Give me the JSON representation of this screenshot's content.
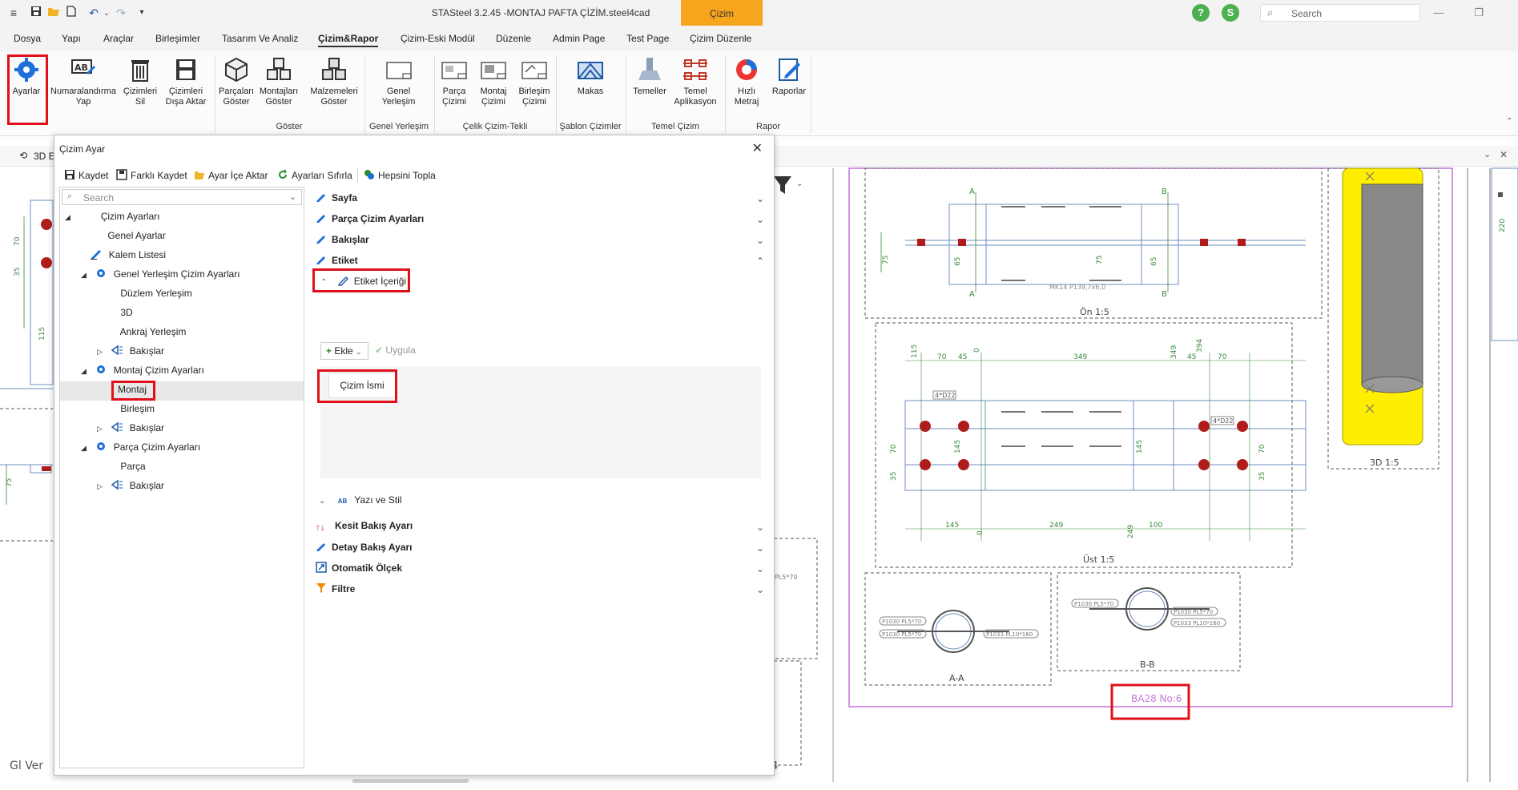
{
  "window": {
    "title": "STASteel 3.2.45 -MONTAJ PAFTA ÇİZİM.steel4cad",
    "search_placeholder": "Search",
    "context_tab_group": "Çizim",
    "user_initial": "S",
    "help_glyph": "?"
  },
  "menu": {
    "items": [
      "Dosya",
      "Yapı",
      "Araçlar",
      "Birleşimler",
      "Tasarım Ve Analiz",
      "Çizim&Rapor",
      "Çizim-Eski Modül",
      "Düzenle",
      "Admin Page",
      "Test Page",
      "Çizim Düzenle"
    ],
    "active": "Çizim&Rapor"
  },
  "ribbon": {
    "buttons": [
      {
        "label": "Ayarlar"
      },
      {
        "label": "Numaralandırma Yap"
      },
      {
        "label": "Çizimleri Sil"
      },
      {
        "label": "Çizimleri Dışa Aktar"
      },
      {
        "label": "Parçaları Göster"
      },
      {
        "label": "Montajları Göster"
      },
      {
        "label": "Malzemeleri Göster"
      },
      {
        "label": "Genel Yerleşim"
      },
      {
        "label": "Parça Çizimi"
      },
      {
        "label": "Montaj Çizimi"
      },
      {
        "label": "Birleşim Çizimi"
      },
      {
        "label": "Makas"
      },
      {
        "label": "Temeller"
      },
      {
        "label": "Temel Aplikasyon"
      },
      {
        "label": "Hızlı Metraj"
      },
      {
        "label": "Raporlar"
      }
    ],
    "groups": [
      "Göster",
      "Genel Yerleşim",
      "Çelik Çizim-Tekli",
      "Şablon Çizimler",
      "Temel Çizim",
      "Rapor"
    ]
  },
  "doc_tabs": {
    "first": "3D E"
  },
  "dialog": {
    "title": "Çizim Ayar",
    "toolbar": [
      "Kaydet",
      "Farklı Kaydet",
      "Ayar İçe Aktar",
      "Ayarları Sıfırla",
      "Hepsini Topla"
    ],
    "tree_search_placeholder": "Search",
    "tree": [
      {
        "label": "Çizim Ayarları",
        "level": 0,
        "expander": "◢"
      },
      {
        "label": "Genel Ayarlar",
        "level": 1,
        "expander": ""
      },
      {
        "label": "Kalem Listesi",
        "level": 1,
        "expander": ""
      },
      {
        "label": "Genel Yerleşim Çizim Ayarları",
        "level": 1,
        "expander": "◢"
      },
      {
        "label": "Düzlem Yerleşim",
        "level": 2,
        "expander": ""
      },
      {
        "label": "3D",
        "level": 2,
        "expander": ""
      },
      {
        "label": "Ankraj Yerleşim",
        "level": 2,
        "expander": ""
      },
      {
        "label": "Bakışlar",
        "level": 2,
        "expander": "▷"
      },
      {
        "label": "Montaj Çizim Ayarları",
        "level": 1,
        "expander": "◢"
      },
      {
        "label": "Montaj",
        "level": 2,
        "expander": ""
      },
      {
        "label": "Birleşim",
        "level": 2,
        "expander": ""
      },
      {
        "label": "Bakışlar",
        "level": 2,
        "expander": "▷"
      },
      {
        "label": "Parça Çizim Ayarları",
        "level": 1,
        "expander": "◢"
      },
      {
        "label": "Parça",
        "level": 2,
        "expander": ""
      },
      {
        "label": "Bakışlar",
        "level": 2,
        "expander": "▷"
      }
    ],
    "selected_tree": "Montaj",
    "sections_top": [
      "Sayfa",
      "Parça Çizim Ayarları",
      "Bakışlar",
      "Etiket"
    ],
    "sub_section": "Etiket İçeriği",
    "ekle": "Ekle",
    "uygula": "Uygula",
    "label_chip": "Çizim İsmi",
    "yazi_stil": "Yazı ve Stil",
    "sections_bottom": [
      "Kesit Bakış Ayarı",
      "Detay Bakış Ayarı",
      "Otomatik Ölçek",
      "Filtre"
    ]
  },
  "drawing": {
    "views": [
      "Ön 1:5",
      "Üst 1:5",
      "A-A",
      "B-B",
      "3D 1:5"
    ],
    "drawing_name": "BA28 No:6",
    "profile_label": "MK14 P139,7x6,0",
    "section_marks": [
      "A",
      "B"
    ],
    "front_dims": [
      "75",
      "65",
      "75",
      "65"
    ],
    "top_dims_row1": [
      "115",
      "70",
      "45",
      "0",
      "349",
      "349",
      "45",
      "70",
      "394"
    ],
    "top_dims_row2": [
      "145",
      "0",
      "249",
      "249",
      "100"
    ],
    "top_side_dims": [
      "70",
      "35",
      "145",
      "145",
      "70",
      "35"
    ],
    "bolt_labels": [
      "4*D22",
      "4*D22"
    ],
    "section_labels_a": [
      "P1030 PL5*70",
      "P1030 PL5*70",
      "P1033 PL10*160"
    ],
    "section_labels_b": [
      "P1030 PL5*70",
      "P1030 PL5*70",
      "P1033 PL10*160"
    ],
    "left_dims": [
      "70",
      "35",
      "115",
      "75"
    ],
    "left_footer": "Gl Ver",
    "bottom_num": "4",
    "right_dim": "220",
    "clipped_label": "PL5*70"
  },
  "colors": {
    "accent_orange": "#f7a51c",
    "highlight_red": "#e0101a",
    "bolt_red": "#b01c1c",
    "dim_green": "#3a8a3a",
    "sheet_purple": "#b04cd0",
    "drawing_blue": "#6f8fc0"
  }
}
